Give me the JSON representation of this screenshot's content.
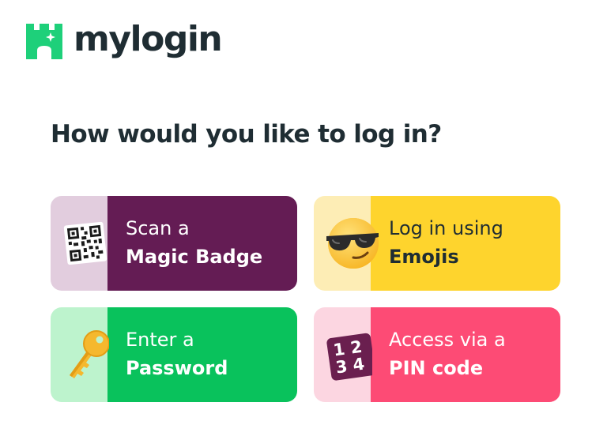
{
  "brand": {
    "name": "mylogin",
    "logo_icon": "castle-icon",
    "logo_color": "#1ed07a"
  },
  "heading": "How would you like to log in?",
  "options": [
    {
      "id": "badge",
      "line1": "Scan a",
      "line2": "Magic Badge",
      "icon": "qr-code-icon",
      "icon_bg": "#e2cdde",
      "bg": "#641c54",
      "text_color": "#ffffff"
    },
    {
      "id": "emoji",
      "line1": "Log in using",
      "line2": "Emojis",
      "icon": "sunglasses-emoji-icon",
      "icon_bg": "#fdedb5",
      "bg": "#fed42d",
      "text_color": "#1f2d33"
    },
    {
      "id": "password",
      "line1": "Enter a",
      "line2": "Password",
      "icon": "key-icon",
      "icon_bg": "#bdf3cd",
      "bg": "#09c25c",
      "text_color": "#ffffff"
    },
    {
      "id": "pin",
      "line1": "Access via a",
      "line2": "PIN code",
      "icon": "pin-pad-icon",
      "icon_digits": "1234",
      "icon_bg": "#fcd6e1",
      "bg": "#fd4b75",
      "text_color": "#ffffff"
    }
  ]
}
